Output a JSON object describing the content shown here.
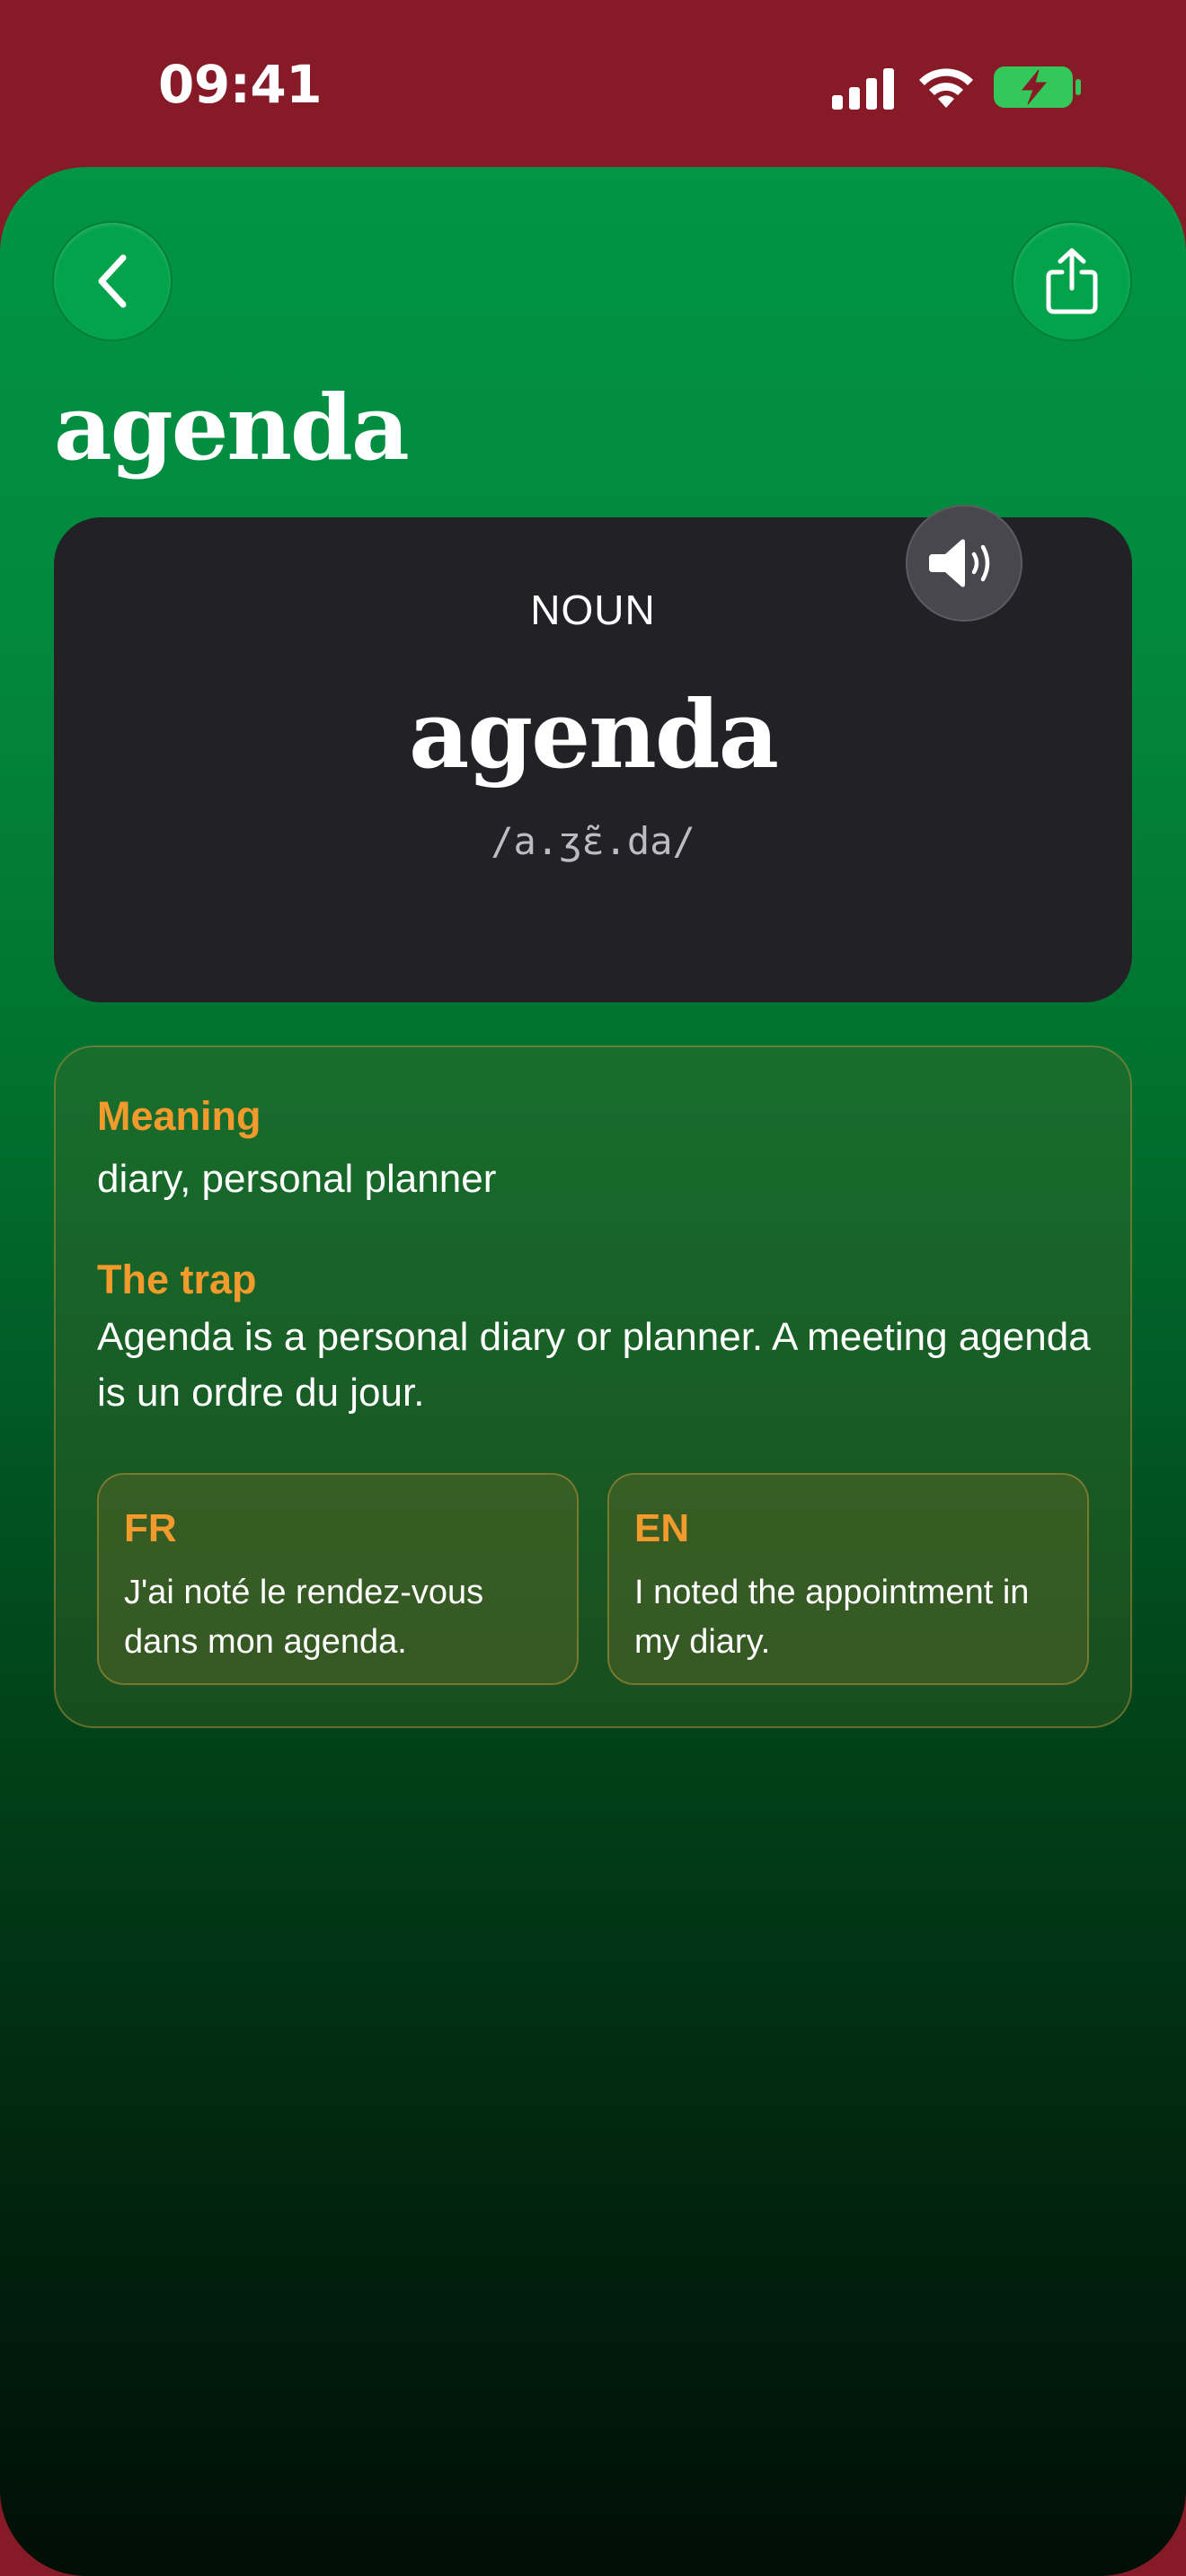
{
  "status_bar": {
    "time": "09:41",
    "icons": [
      "cellular-signal-icon",
      "wifi-icon",
      "battery-charging-icon"
    ]
  },
  "header": {
    "back_icon": "chevron-left-icon",
    "share_icon": "share-icon",
    "title": "agenda"
  },
  "word_card": {
    "part_of_speech": "NOUN",
    "word": "agenda",
    "pronunciation": "/a.ʒɛ̃.da/",
    "speaker_icon": "speaker-icon"
  },
  "info": {
    "meaning_label": "Meaning",
    "meaning_text": "diary, personal planner",
    "trap_label": "The trap",
    "trap_text": "Agenda is a personal diary or planner. A meeting agenda is un ordre du jour.",
    "examples": [
      {
        "lang": "FR",
        "text": "J'ai noté le rendez-vous dans mon agenda."
      },
      {
        "lang": "EN",
        "text": "I noted the appointment in my diary."
      }
    ]
  },
  "colors": {
    "top_bar": "#861a26",
    "sheet_green": "#019545",
    "card_dark": "#222126",
    "accent_orange": "#f39a2c"
  }
}
